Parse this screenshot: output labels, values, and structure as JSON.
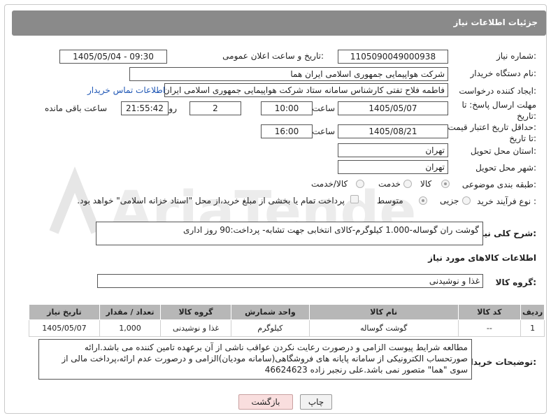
{
  "header": {
    "title": "جزئیات اطلاعات نیاز"
  },
  "form": {
    "need_number_label": "شماره نیاز:",
    "need_number": "1105090049000938",
    "announce_label": "تاریخ و ساعت اعلان عمومی:",
    "announce_value": "1405/05/04 - 09:30",
    "buyer_org_label": "نام دستگاه خریدار:",
    "buyer_org": "شرکت هواپیمایی جمهوری اسلامی ایران هما",
    "requester_label": "ایجاد کننده درخواست:",
    "requester": "فاطمه فلاح تفتی کارشناس سامانه ستاد شرکت هواپیمایی جمهوری اسلامی ایران",
    "contact_link": "اطلاعات تماس خریدار",
    "deadline_label_1": "مهلت ارسال پاسخ: تا",
    "deadline_label_2": "تاریخ:",
    "deadline_date": "1405/05/07",
    "time_label": "ساعت",
    "deadline_time": "10:00",
    "days_value": "2",
    "days_label": "روز و",
    "remaining_time": "21:55:42",
    "remaining_label": "ساعت باقی مانده",
    "validity_label_1": "حداقل تاریخ اعتبار قیمت:",
    "validity_label_2": "تا تاریخ:",
    "validity_date": "1405/08/21",
    "validity_time": "16:00",
    "province_label": "استان محل تحویل:",
    "province": "تهران",
    "city_label": "شهر محل تحویل:",
    "city": "تهران",
    "category_label": "طبقه بندی موضوعی:",
    "category_options": [
      "کالا",
      "خدمت",
      "کالا/خدمت"
    ],
    "process_label": "نوع فرآیند خرید :",
    "process_options": [
      "جزیی",
      "متوسط"
    ],
    "payment_note": "پرداخت تمام یا بخشی از مبلغ خرید،از محل \"اسناد خزانه اسلامی\" خواهد بود.",
    "description_label": "شرح کلی نیاز:",
    "description": "گوشت ران گوساله-1.000 کیلوگرم-کالای انتخابی جهت تشابه- پرداخت:90 روز اداری",
    "goods_info_title": "اطلاعات کالاهای مورد نیاز",
    "goods_group_label": "گروه کالا:",
    "goods_group": "غذا و نوشیدنی"
  },
  "table": {
    "headers": [
      "ردیف",
      "کد کالا",
      "نام کالا",
      "واحد شمارش",
      "گروه کالا",
      "تعداد / مقدار",
      "تاریخ نیاز"
    ],
    "rows": [
      [
        "1",
        "--",
        "گوشت گوساله",
        "کیلوگرم",
        "غذا و نوشیدنی",
        "1,000",
        "1405/05/07"
      ]
    ]
  },
  "notes": {
    "label": "توضیحات خریدار:",
    "text": "مطالعه شرایط پیوست الزامی و درصورت رعایت نکردن عواقب ناشی از آن برعهده تامین کننده می باشد.ارائه صورتحساب الکترونیکی از سامانه پایانه های فروشگاهی(سامانه مودیان)الزامی و درصورت عدم ارائه،پرداخت مالی از سوی \"هما\" متصور نمی باشد.علی رنجبر زاده 46624623"
  },
  "buttons": {
    "print": "چاپ",
    "back": "بازگشت"
  },
  "watermark": {
    "text": "AriaTender.neT"
  }
}
